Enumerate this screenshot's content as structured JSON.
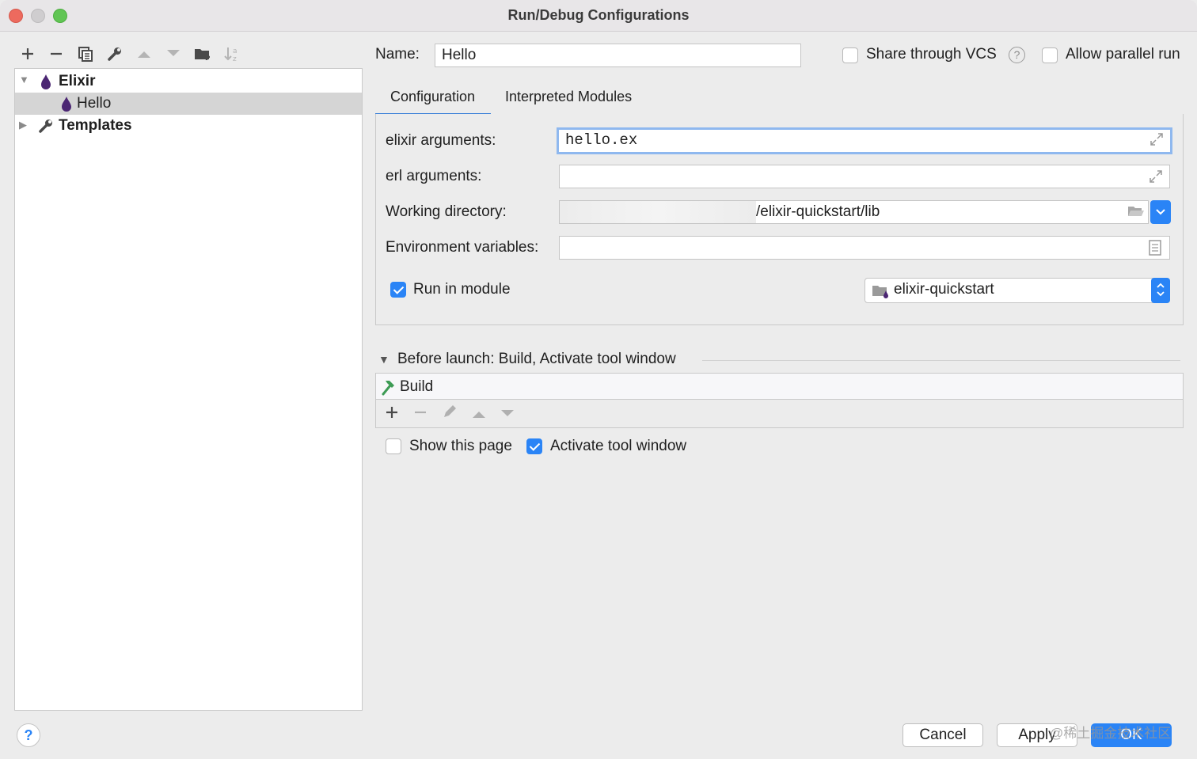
{
  "window": {
    "title": "Run/Debug Configurations"
  },
  "toolbar": {
    "icons": [
      "plus-icon",
      "minus-icon",
      "copy-icon",
      "wrench-icon",
      "arrow-up-icon",
      "arrow-down-icon",
      "folder-add-icon",
      "sort-icon"
    ]
  },
  "tree": {
    "group": "Elixir",
    "child": "Hello",
    "templates": "Templates"
  },
  "header": {
    "name_label": "Name:",
    "name_value": "Hello",
    "share_vcs": "Share through VCS",
    "allow_parallel": "Allow parallel run"
  },
  "tabs": [
    {
      "label": "Configuration",
      "active": true
    },
    {
      "label": "Interpreted Modules",
      "active": false
    }
  ],
  "config": {
    "elixir_args_label": "elixir arguments:",
    "elixir_args_value": "hello.ex",
    "erl_args_label": "erl arguments:",
    "erl_args_value": "",
    "workdir_label": "Working directory:",
    "workdir_value": "/elixir-quickstart/lib",
    "env_label": "Environment variables:",
    "env_value": "",
    "run_in_module_label": "Run in module",
    "run_in_module_checked": true,
    "module_value": "elixir-quickstart"
  },
  "before_launch": {
    "header": "Before launch: Build, Activate tool window",
    "task": "Build",
    "show_page": "Show this page",
    "show_page_checked": false,
    "activate_tool": "Activate tool window",
    "activate_tool_checked": true
  },
  "footer": {
    "help": "?",
    "cancel": "Cancel",
    "apply": "Apply",
    "ok": "OK",
    "watermark": "@稀土掘金技术社区"
  },
  "colors": {
    "accent": "#2a84f6",
    "elixir": "#4b2673",
    "build": "#3d9b54"
  }
}
